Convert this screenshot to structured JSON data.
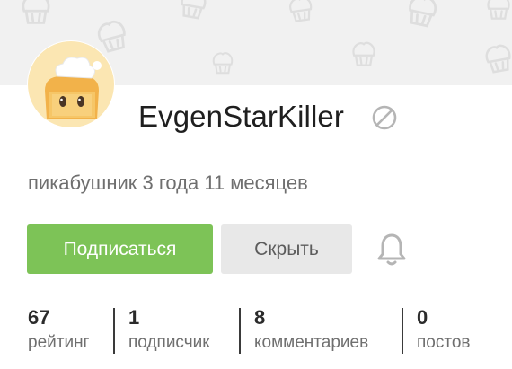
{
  "profile": {
    "username": "EvgenStarKiller",
    "tenure": "пикабушник 3 года 11 месяцев"
  },
  "actions": {
    "subscribe_label": "Подписаться",
    "hide_label": "Скрыть"
  },
  "stats": [
    {
      "value": "67",
      "label": "рейтинг"
    },
    {
      "value": "1",
      "label": "подписчик"
    },
    {
      "value": "8",
      "label": "комментариев"
    },
    {
      "value": "0",
      "label": "постов"
    }
  ],
  "icons": {
    "status": "ban-icon",
    "notifications": "bell-icon",
    "avatar": "chef-toast-avatar"
  },
  "colors": {
    "accent": "#7dc357",
    "secondary_button": "#e8e8e8",
    "icon_gray": "#b5b5b5",
    "cover_bg": "#f1f1f1"
  }
}
